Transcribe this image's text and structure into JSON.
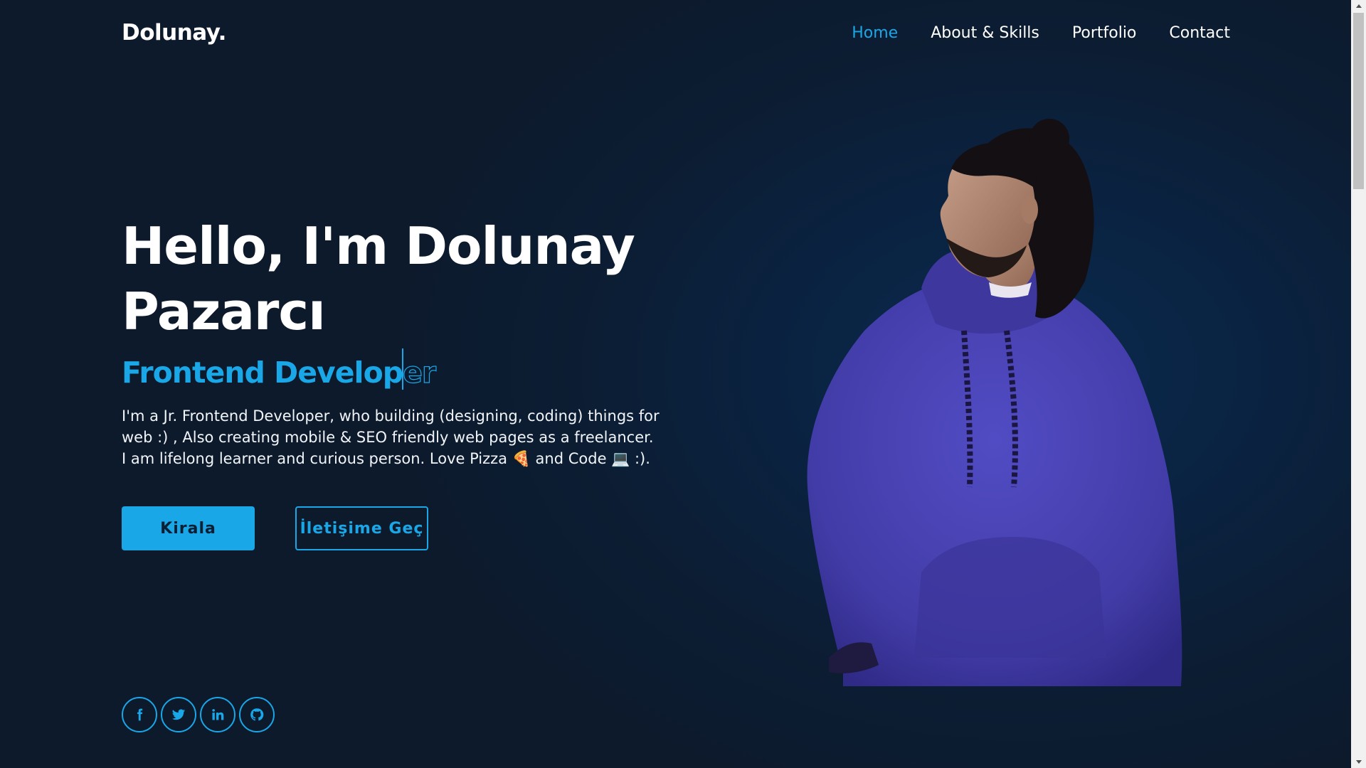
{
  "header": {
    "logo": "Dolunay.",
    "nav": [
      {
        "label": "Home",
        "active": true
      },
      {
        "label": "About & Skills",
        "active": false
      },
      {
        "label": "Portfolio",
        "active": false
      },
      {
        "label": "Contact",
        "active": false
      }
    ]
  },
  "hero": {
    "title": "Hello, I'm Dolunay Pazarcı",
    "role_typed": "Frontend Develop",
    "role_remaining": "er",
    "bio": "I'm a Jr. Frontend Developer, who building (designing, coding) things for web :) , Also creating mobile & SEO friendly web pages as a freelancer. I am lifelong learner and curious person. Love Pizza 🍕 and Code 💻 :).",
    "primary_button": "Kirala",
    "secondary_button": "İletişime Geç"
  },
  "socials": [
    {
      "icon": "facebook-icon"
    },
    {
      "icon": "twitter-icon"
    },
    {
      "icon": "linkedin-icon"
    },
    {
      "icon": "github-icon"
    }
  ],
  "colors": {
    "accent": "#19a7e8",
    "background": "#0d1a2c",
    "hoodie": "#4a45b8"
  }
}
